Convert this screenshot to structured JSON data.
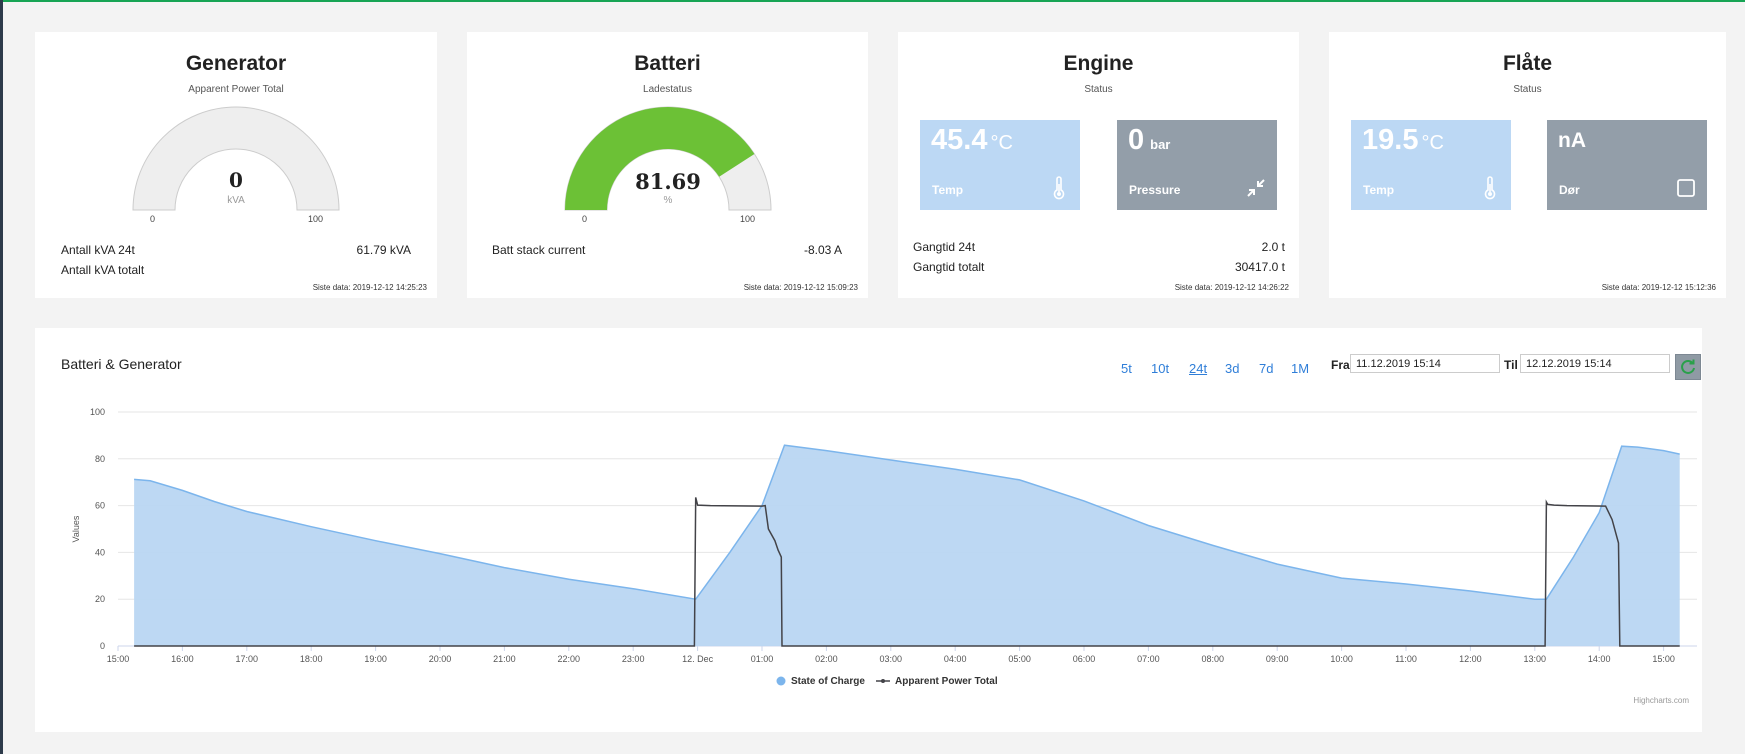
{
  "generator": {
    "title": "Generator",
    "subtitle": "Apparent Power Total",
    "gauge": {
      "value": "0",
      "value_num": 0,
      "min": "0",
      "max": "100",
      "unit": "kVA"
    },
    "rows": [
      {
        "label": "Antall kVA 24t",
        "value": "61.79 kVA"
      },
      {
        "label": "Antall kVA totalt",
        "value": ""
      }
    ],
    "siste": "Siste data: 2019-12-12 14:25:23"
  },
  "batteri": {
    "title": "Batteri",
    "subtitle": "Ladestatus",
    "gauge": {
      "value": "81.69",
      "value_num": 81.69,
      "min": "0",
      "max": "100",
      "unit": "%"
    },
    "rows": [
      {
        "label": "Batt stack current",
        "value": "-8.03 A"
      }
    ],
    "siste": "Siste data: 2019-12-12 15:09:23",
    "fill_color": "#6cc136"
  },
  "engine": {
    "title": "Engine",
    "subtitle": "Status",
    "tiles": [
      {
        "value": "45.4",
        "unit": "°C",
        "label": "Temp",
        "icon": "thermometer-icon"
      },
      {
        "value": "0",
        "unit": "bar",
        "label": "Pressure",
        "icon": "compress-arrows-icon"
      }
    ],
    "rows": [
      {
        "label": "Gangtid 24t",
        "value": "2.0 t"
      },
      {
        "label": "Gangtid totalt",
        "value": "30417.0 t"
      }
    ],
    "siste": "Siste data: 2019-12-12 14:26:22"
  },
  "flate": {
    "title": "Flåte",
    "subtitle": "Status",
    "tiles": [
      {
        "value": "19.5",
        "unit": "°C",
        "label": "Temp",
        "icon": "thermometer-icon"
      },
      {
        "value": "nA",
        "unit": "",
        "label": "Dør",
        "icon": "checkbox-icon"
      }
    ],
    "siste": "Siste data: 2019-12-12 15:12:36"
  },
  "colors": {
    "accent": "#17a454",
    "tile_light": "#bcd8f4",
    "tile_gray": "#939ea9",
    "link": "#2f7ed8",
    "area_fill": "#b9d6f2",
    "area_line": "#7cb5ec",
    "power_line": "#434348"
  },
  "chart_panel": {
    "title": "Batteri & Generator",
    "ranges": [
      "5t",
      "10t",
      "24t",
      "3d",
      "7d",
      "1M"
    ],
    "active_range": "24t",
    "fra_label": "Fra",
    "fra_value": "11.12.2019 15:14",
    "til_label": "Til",
    "til_value": "12.12.2019 15:14",
    "refresh_icon": "refresh-icon",
    "credits": "Highcharts.com"
  },
  "chart_data": {
    "type": "area",
    "title": "",
    "ylabel": "Values",
    "ylim": [
      0,
      100
    ],
    "yticks": [
      0,
      20,
      40,
      60,
      80,
      100
    ],
    "x_tick_labels": [
      "15:00",
      "16:00",
      "17:00",
      "18:00",
      "19:00",
      "20:00",
      "21:00",
      "22:00",
      "23:00",
      "12. Dec",
      "01:00",
      "02:00",
      "03:00",
      "04:00",
      "05:00",
      "06:00",
      "07:00",
      "08:00",
      "09:00",
      "10:00",
      "11:00",
      "12:00",
      "13:00",
      "14:00",
      "15:00"
    ],
    "xlim_hours": [
      0,
      24.35
    ],
    "grid": true,
    "legend_position": "bottom-center",
    "series": [
      {
        "name": "State of Charge",
        "kind": "area",
        "x_hours": [
          0.25,
          0.5,
          1,
          1.5,
          2,
          3,
          4,
          5,
          6,
          7,
          8,
          8.97,
          9.5,
          10,
          10.35,
          11,
          12,
          13,
          14,
          15,
          16,
          17,
          18,
          19,
          20,
          21,
          22,
          22.18,
          22.6,
          23,
          23.35,
          23.6,
          24,
          24.25
        ],
        "values": [
          71.2,
          70.6,
          66.5,
          61.7,
          57.5,
          51,
          45,
          39.5,
          33.5,
          28.5,
          24.5,
          20,
          40,
          60,
          85.8,
          83.5,
          79.5,
          75.5,
          71,
          62,
          51.5,
          43,
          35,
          29,
          26.5,
          23.5,
          20,
          20,
          38,
          57,
          85.4,
          85,
          83.5,
          82
        ]
      },
      {
        "name": "Apparent Power Total",
        "kind": "line",
        "x_hours": [
          0.25,
          8.95,
          8.97,
          9.0,
          9.2,
          10.0,
          10.05,
          10.1,
          10.2,
          10.25,
          10.3,
          10.31,
          22.16,
          22.18,
          22.2,
          22.3,
          22.5,
          23.1,
          23.2,
          23.3,
          23.32,
          24.25
        ],
        "values": [
          0,
          0,
          63.5,
          60.2,
          60,
          59.8,
          60,
          50,
          45,
          41,
          38,
          0,
          0,
          61.5,
          60.5,
          60.2,
          60,
          59.8,
          54,
          44,
          0,
          0
        ]
      }
    ]
  }
}
